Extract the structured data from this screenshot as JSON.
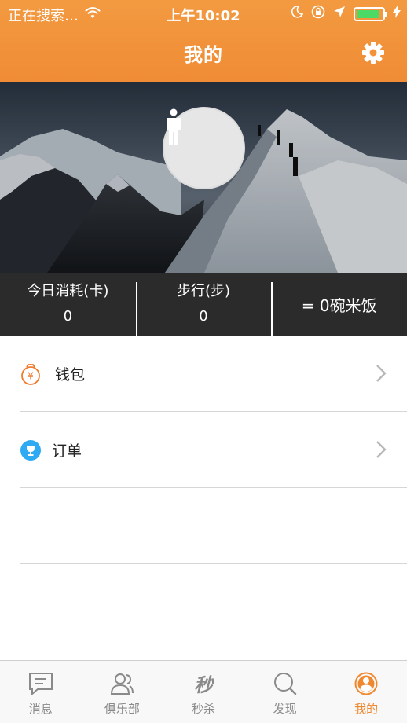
{
  "status_bar": {
    "carrier": "正在搜索…",
    "time": "上午10:02",
    "battery_level": 0.9
  },
  "nav": {
    "title": "我的",
    "settings_icon": "gear-icon"
  },
  "profile": {
    "avatar_icon": "person-silhouette-icon"
  },
  "stats": [
    {
      "label": "今日消耗(卡)",
      "value": "0"
    },
    {
      "label": "步行(步)",
      "value": "0"
    },
    {
      "label": "= 0碗米饭",
      "value": ""
    }
  ],
  "menu": [
    {
      "label": "钱包",
      "icon": "wallet-yen-icon",
      "color": "#f07a2c"
    },
    {
      "label": "订单",
      "icon": "trophy-icon",
      "color": "#2eaaf2"
    }
  ],
  "tabs": [
    {
      "label": "消息",
      "icon": "message-icon",
      "active": false
    },
    {
      "label": "俱乐部",
      "icon": "club-people-icon",
      "active": false
    },
    {
      "label": "秒杀",
      "icon": "flash-sale-icon",
      "glyph": "秒",
      "active": false
    },
    {
      "label": "发现",
      "icon": "discover-search-icon",
      "active": false
    },
    {
      "label": "我的",
      "icon": "me-profile-icon",
      "active": true
    }
  ],
  "colors": {
    "accent": "#f0882f",
    "header": "#f39a41",
    "stats_bg": "#2b2b2b"
  }
}
